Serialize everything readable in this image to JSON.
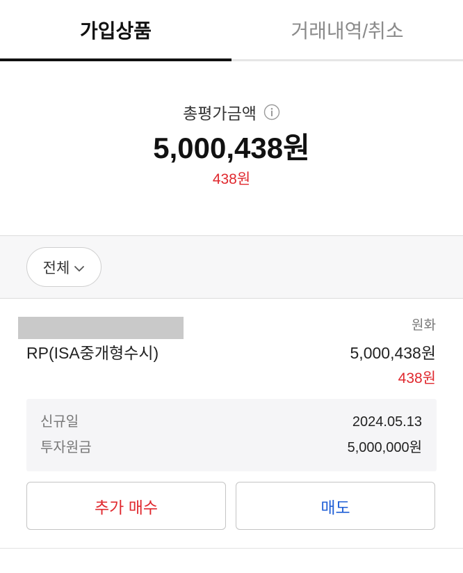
{
  "tabs": [
    {
      "label": "가입상품",
      "active": true
    },
    {
      "label": "거래내역/취소",
      "active": false
    }
  ],
  "summary": {
    "title": "총평가금액",
    "icon": "info-icon",
    "total_amount": "5,000,438원",
    "profit": "438원"
  },
  "filter": {
    "selected": "전체",
    "icon": "chevron-down-icon"
  },
  "products": [
    {
      "currency": "원화",
      "name": "RP(ISA중개형수시)",
      "amount": "5,000,438원",
      "profit": "438원",
      "details": [
        {
          "label": "신규일",
          "value": "2024.05.13"
        },
        {
          "label": "투자원금",
          "value": "5,000,000원"
        }
      ],
      "buy_button": "추가 매수",
      "sell_button": "매도"
    }
  ],
  "colors": {
    "primary_text": "#111111",
    "profit": "#e0282e",
    "sell": "#1f5fd6",
    "muted": "#777777"
  }
}
